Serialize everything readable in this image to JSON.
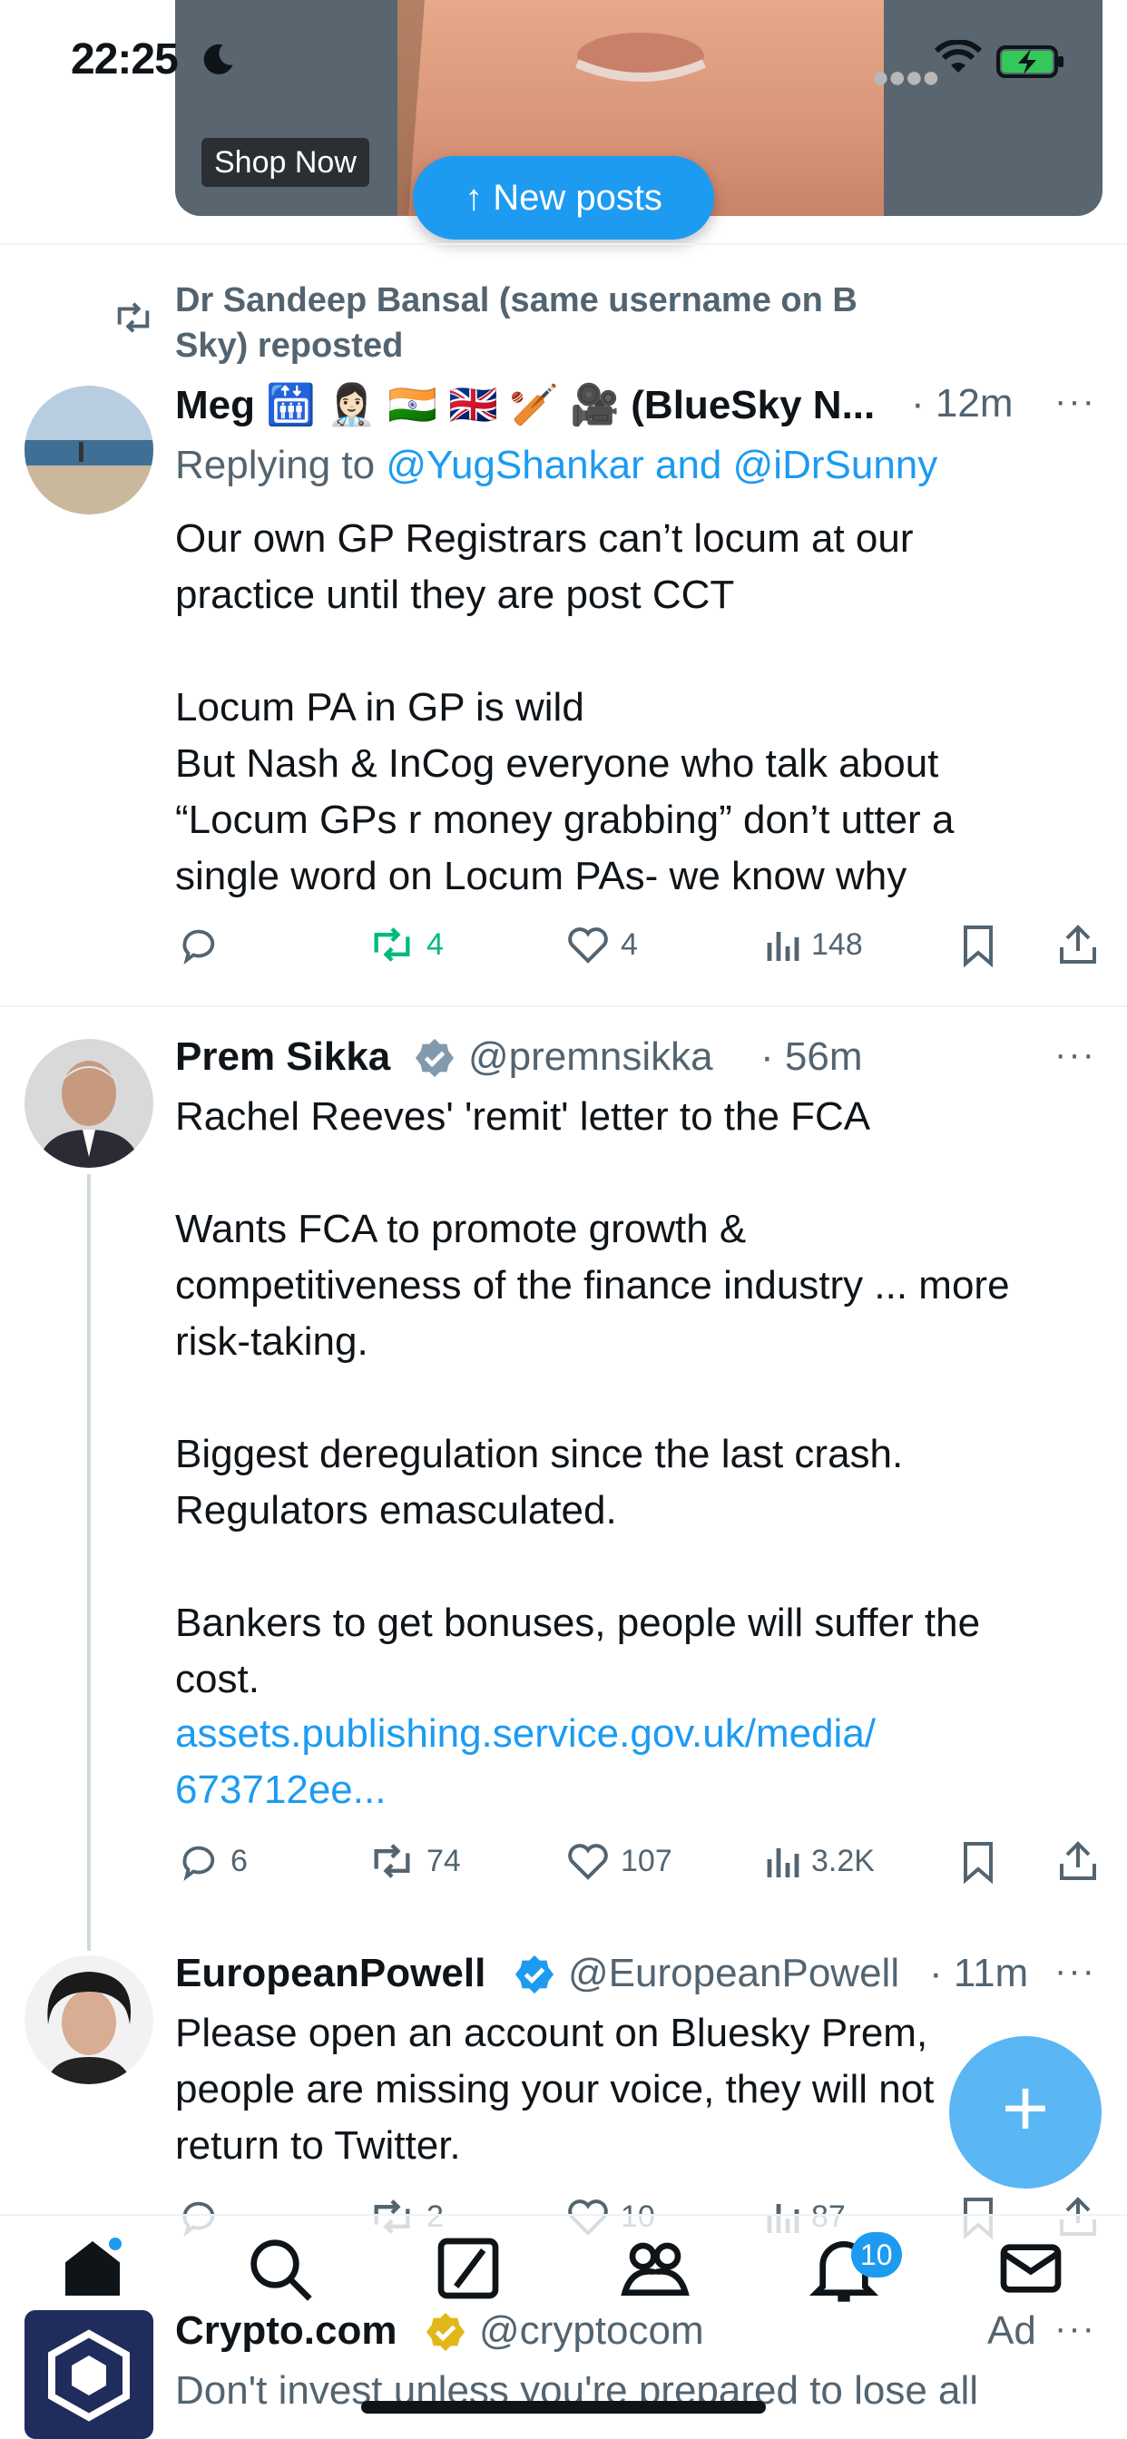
{
  "status_bar": {
    "time": "22:25"
  },
  "ad_top": {
    "shop_now": "Shop Now"
  },
  "new_posts": {
    "label": "New posts",
    "arrow": "↑"
  },
  "tweets": [
    {
      "repost_by": "Dr Sandeep Bansal (same username on B\nSky) reposted",
      "name": "Meg 🛗 👩🏻‍⚕️ 🇮🇳 🇬🇧 🏏 🎥 (BlueSky N...",
      "time": "· 12m",
      "replying_prefix": "Replying to ",
      "replying_to": "@YugShankar and @iDrSunny",
      "text": "Our own GP Registrars can’t locum at our\npractice until they are post CCT\n\nLocum PA in GP is wild\nBut Nash & InCog everyone who talk about\n“Locum GPs r money grabbing” don’t utter a\nsingle word on Locum PAs- we know why",
      "replies": "",
      "reposts": "4",
      "likes": "4",
      "views": "148"
    },
    {
      "name": "Prem Sikka",
      "handle": "@premnsikka",
      "time": "· 56m",
      "text": "Rachel Reeves' 'remit' letter to the FCA\n\nWants FCA to promote growth &\ncompetitiveness of the finance industry ... more\nrisk-taking.\n\nBiggest deregulation since the last crash.\nRegulators emasculated.\n\nBankers to get bonuses, people will suffer the\ncost.",
      "link": "assets.publishing.service.gov.uk/media/\n673712ee...",
      "replies": "6",
      "reposts": "74",
      "likes": "107",
      "views": "3.2K"
    },
    {
      "name": "EuropeanPowell",
      "handle": "@EuropeanPowell",
      "time": "· 11m",
      "text": "Please open an account on Bluesky Prem,\npeople are missing your voice, they will not\nreturn to Twitter.",
      "replies": "",
      "reposts": "2",
      "likes": "10",
      "views": "87"
    },
    {
      "name": "Crypto.com",
      "handle": "@cryptocom",
      "ad_label": "Ad",
      "text": "Don't invest unless you're prepared to lose all"
    }
  ],
  "bottom_nav": {
    "notifications_badge": "10"
  },
  "colors": {
    "accent": "#1d9bf0",
    "repost_green": "#00ba7c",
    "muted": "#536471"
  }
}
